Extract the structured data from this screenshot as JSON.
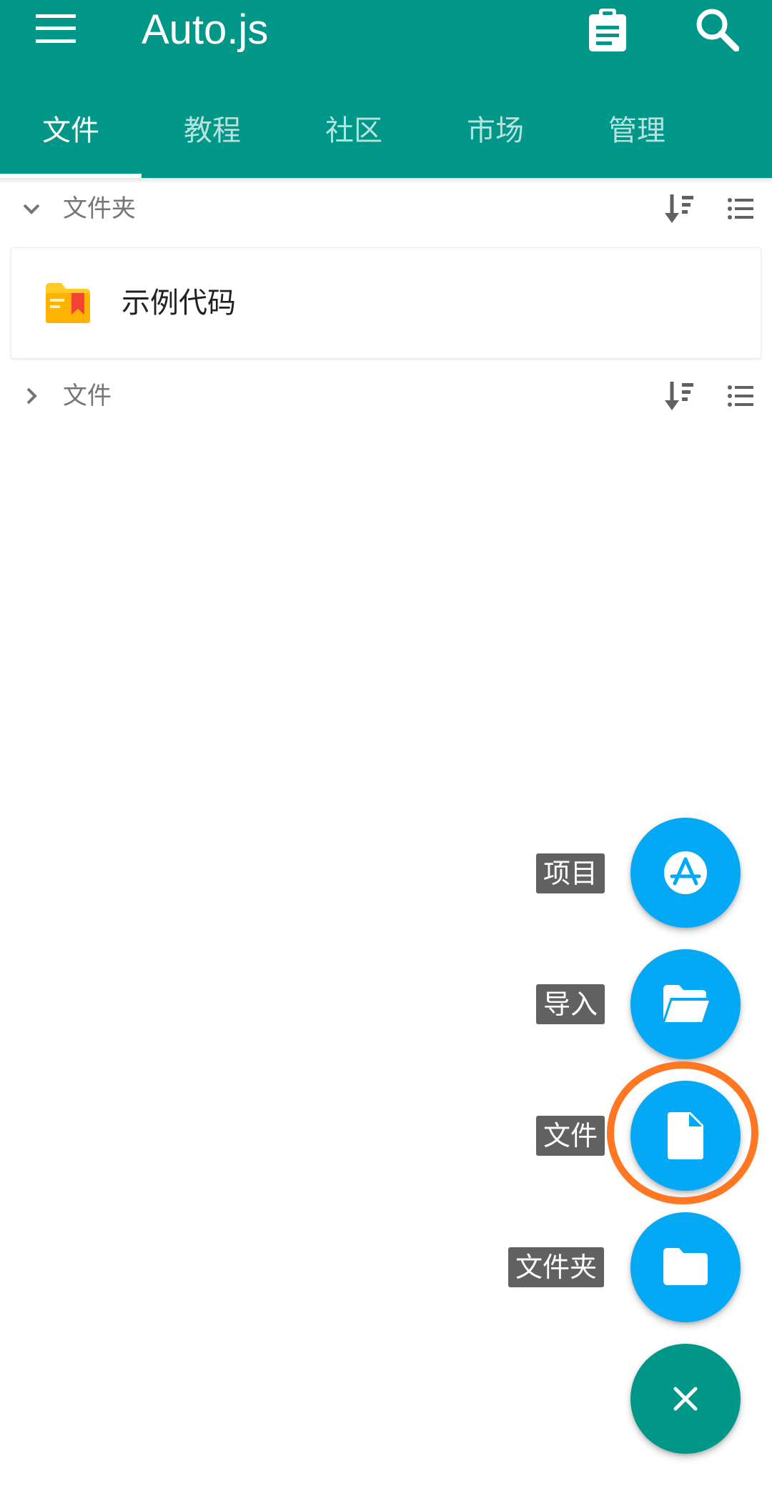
{
  "app": {
    "title": "Auto.js"
  },
  "appbar": {
    "menu_icon": "hamburger-menu-icon",
    "clipboard_icon": "clipboard-icon",
    "search_icon": "search-icon",
    "color": "#009688"
  },
  "tabs": [
    {
      "label": "文件",
      "active": true
    },
    {
      "label": "教程",
      "active": false
    },
    {
      "label": "社区",
      "active": false
    },
    {
      "label": "市场",
      "active": false
    },
    {
      "label": "管理",
      "active": false
    }
  ],
  "sections": {
    "folders": {
      "title": "文件夹",
      "expanded": true,
      "items": [
        {
          "name": "示例代码",
          "icon": "folder-icon"
        }
      ]
    },
    "files": {
      "title": "文件",
      "expanded": false
    }
  },
  "fab_menu": {
    "items": [
      {
        "label": "项目",
        "icon": "app-store-icon"
      },
      {
        "label": "导入",
        "icon": "open-folder-icon"
      },
      {
        "label": "文件",
        "icon": "file-icon"
      },
      {
        "label": "文件夹",
        "icon": "folder-icon"
      }
    ],
    "main_icon": "close-icon",
    "fab_color": "#03a9f4",
    "main_color": "#009688",
    "highlight_color": "#ff7722"
  }
}
